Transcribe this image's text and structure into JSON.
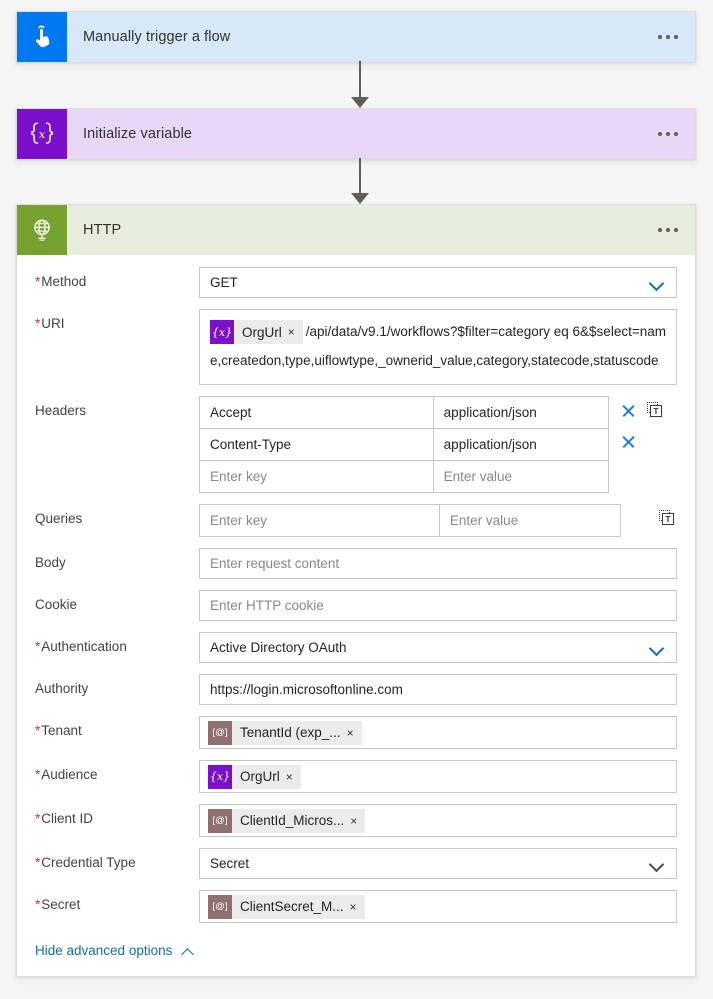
{
  "flow": {
    "nodes": [
      {
        "id": "trigger",
        "title": "Manually trigger a flow",
        "icon": "manual-trigger-hand-icon",
        "accent": "#0078f0",
        "header_bg": "#d7e8f8"
      },
      {
        "id": "init-variable",
        "title": "Initialize variable",
        "icon": "variable-braces-icon",
        "accent": "#7a0fcc",
        "header_bg": "#e8d7f6"
      },
      {
        "id": "http",
        "title": "HTTP",
        "icon": "globe-icon",
        "accent": "#78a22f",
        "header_bg": "#e7edde"
      }
    ],
    "menu_label": "more-commands"
  },
  "http_form": {
    "method": {
      "label": "Method",
      "required": true,
      "value": "GET"
    },
    "uri": {
      "label": "URI",
      "required": true,
      "token": {
        "icon": "{x}",
        "kind": "variable",
        "name": "OrgUrl",
        "remove": "×"
      },
      "text": "/api/data/v9.1/workflows?$filter=category eq 6&$select=name,createdon,type,uiflowtype,_ownerid_value,category,statecode,statuscode"
    },
    "headers": {
      "label": "Headers",
      "rows": [
        {
          "key": "Accept",
          "value": "application/json",
          "has_delete": true,
          "has_textmode": true
        },
        {
          "key": "Content-Type",
          "value": "application/json",
          "has_delete": true,
          "has_textmode": false
        },
        {
          "key": "",
          "value": "",
          "key_placeholder": "Enter key",
          "value_placeholder": "Enter value",
          "has_delete": false,
          "has_textmode": false
        }
      ]
    },
    "queries": {
      "label": "Queries",
      "key_placeholder": "Enter key",
      "value_placeholder": "Enter value",
      "has_textmode": true
    },
    "body": {
      "label": "Body",
      "placeholder": "Enter request content",
      "value": ""
    },
    "cookie": {
      "label": "Cookie",
      "placeholder": "Enter HTTP cookie",
      "value": ""
    },
    "authentication": {
      "label": "Authentication",
      "required": true,
      "value": "Active Directory OAuth"
    },
    "authority": {
      "label": "Authority",
      "required": false,
      "value": "https://login.microsoftonline.com"
    },
    "tenant": {
      "label": "Tenant",
      "required": true,
      "token": {
        "icon": "[@]",
        "kind": "environment",
        "name": "TenantId (exp_...",
        "remove": "×"
      }
    },
    "audience": {
      "label": "Audience",
      "required": true,
      "token": {
        "icon": "{x}",
        "kind": "variable",
        "name": "OrgUrl",
        "remove": "×"
      }
    },
    "client_id": {
      "label": "Client ID",
      "required": true,
      "token": {
        "icon": "[@]",
        "kind": "environment",
        "name": "ClientId_Micros...",
        "remove": "×"
      }
    },
    "credential_type": {
      "label": "Credential Type",
      "required": true,
      "value": "Secret"
    },
    "secret": {
      "label": "Secret",
      "required": true,
      "token": {
        "icon": "[@]",
        "kind": "environment",
        "name": "ClientSecret_M...",
        "remove": "×"
      }
    },
    "advanced_toggle": {
      "label": "Hide advanced options",
      "icon": "chevron-up-icon"
    },
    "tools": {
      "delete_icon": "close-icon",
      "text_mode_icon": "switch-to-text-mode-icon",
      "text_mode_glyph": "T"
    }
  },
  "colors": {
    "link": "#0f6cbd",
    "required": "#d13438",
    "chip_variable": "#7a0fcc",
    "chip_environment": "#8f6f6f",
    "delete": "#1a7ae8"
  }
}
